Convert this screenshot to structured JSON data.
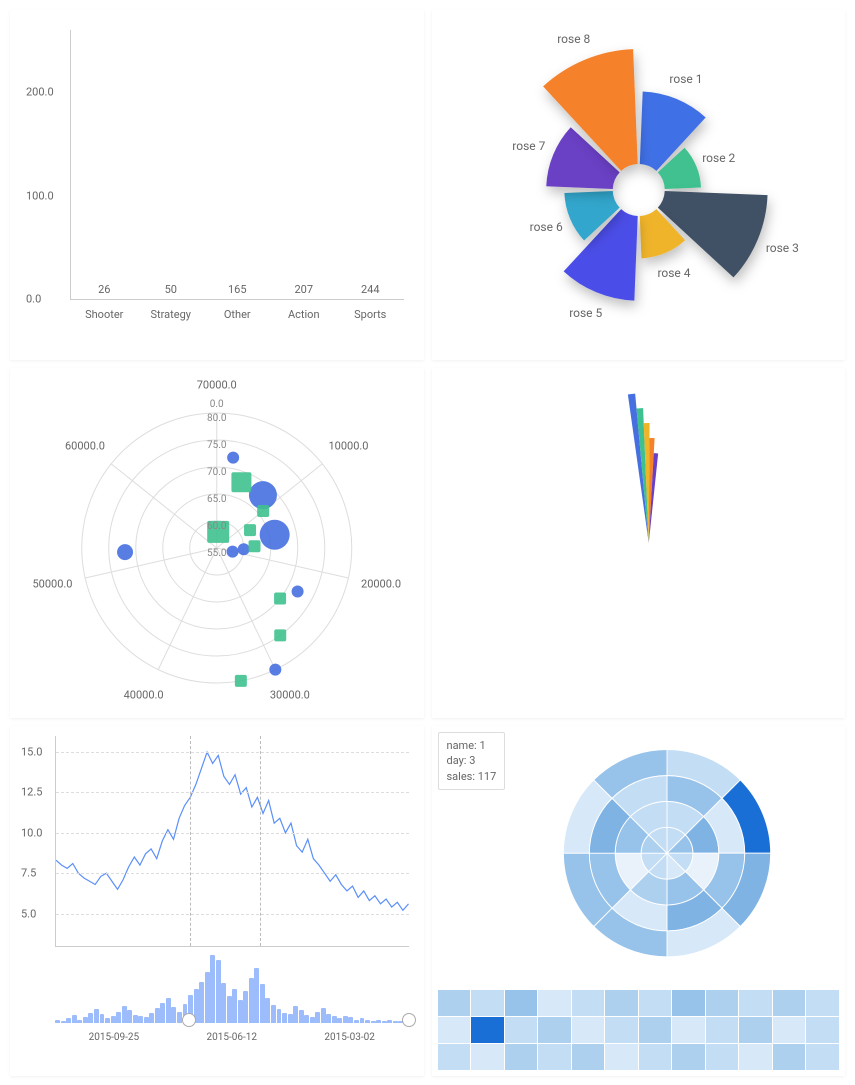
{
  "chart_data": [
    {
      "id": "bar",
      "type": "bar",
      "categories": [
        "Shooter",
        "Strategy",
        "Other",
        "Action",
        "Sports"
      ],
      "values": [
        26,
        50,
        165,
        207,
        244
      ],
      "ylim": [
        0,
        260
      ],
      "yticks": [
        0.0,
        100.0,
        200.0
      ],
      "bar_color": "#1890ff"
    },
    {
      "id": "rose",
      "type": "pie",
      "subtype": "nightingale-rose",
      "series": [
        {
          "name": "rose 1",
          "value": 60,
          "color": "#3f6fe6"
        },
        {
          "name": "rose 2",
          "value": 30,
          "color": "#3fc18f"
        },
        {
          "name": "rose 3",
          "value": 85,
          "color": "#415165"
        },
        {
          "name": "rose 4",
          "value": 35,
          "color": "#f0b429"
        },
        {
          "name": "rose 5",
          "value": 70,
          "color": "#4b4ee8"
        },
        {
          "name": "rose 6",
          "value": 40,
          "color": "#33a6cc"
        },
        {
          "name": "rose 7",
          "value": 55,
          "color": "#6a3fc4"
        },
        {
          "name": "rose 8",
          "value": 95,
          "color": "#f5822b"
        }
      ]
    },
    {
      "id": "polar_scatter",
      "type": "scatter",
      "coord": "polar",
      "radial_axis": {
        "label": "",
        "ticks": [
          55.0,
          60.0,
          65.0,
          70.0,
          75.0,
          80.0,
          0.0
        ]
      },
      "angle_axis": {
        "ticks": [
          10000.0,
          20000.0,
          30000.0,
          40000.0,
          50000.0,
          60000.0,
          70000.0
        ]
      },
      "series": [
        {
          "name": "blue",
          "marker": "circle",
          "color": "#4670e0",
          "points": [
            {
              "angle": 2000,
              "radius": 72,
              "size": 12
            },
            {
              "angle": 8000,
              "radius": 68,
              "size": 28
            },
            {
              "angle": 15000,
              "radius": 66,
              "size": 30
            },
            {
              "angle": 18000,
              "radius": 60,
              "size": 12
            },
            {
              "angle": 20000,
              "radius": 58,
              "size": 12
            },
            {
              "angle": 23000,
              "radius": 72,
              "size": 12
            },
            {
              "angle": 30000,
              "radius": 80,
              "size": 12
            },
            {
              "angle": 52000,
              "radius": 72,
              "size": 16
            }
          ]
        },
        {
          "name": "green",
          "marker": "square",
          "color": "#3fc18f",
          "points": [
            {
              "angle": 4000,
              "radius": 68,
              "size": 20
            },
            {
              "angle": 1000,
              "radius": 58,
              "size": 22
            },
            {
              "angle": 10000,
              "radius": 66,
              "size": 12
            },
            {
              "angle": 12000,
              "radius": 62,
              "size": 12
            },
            {
              "angle": 17000,
              "radius": 62,
              "size": 12
            },
            {
              "angle": 25000,
              "radius": 70,
              "size": 12
            },
            {
              "angle": 28000,
              "radius": 75,
              "size": 12
            },
            {
              "angle": 33000,
              "radius": 80,
              "size": 12
            }
          ]
        }
      ]
    },
    {
      "id": "building_rose",
      "type": "pie",
      "subtype": "narrow-fan",
      "series": [
        {
          "color": "#4670e0",
          "value": 100
        },
        {
          "color": "#3fc18f",
          "value": 90
        },
        {
          "color": "#f0b429",
          "value": 80
        },
        {
          "color": "#f5822b",
          "value": 70
        },
        {
          "color": "#6a3fc4",
          "value": 60
        }
      ],
      "start_angle": -8,
      "end_angle": 6
    },
    {
      "id": "timeseries",
      "type": "line",
      "xlabel": "",
      "ylabel": "",
      "xticks": [
        "2015-09-25",
        "2015-06-12",
        "2015-03-02"
      ],
      "yticks": [
        5.0,
        7.5,
        10.0,
        12.5,
        15.0
      ],
      "ylim": [
        3,
        16
      ],
      "cursor_positions": [
        0.38,
        0.58
      ],
      "brush_handles": [
        0.38,
        1.0
      ],
      "color": "#5b8ff9",
      "points": [
        8.3,
        8.0,
        7.8,
        8.1,
        7.5,
        7.2,
        7.0,
        6.8,
        7.3,
        7.5,
        7.0,
        6.5,
        7.1,
        7.9,
        8.5,
        8.0,
        8.7,
        9.0,
        8.4,
        9.5,
        10.2,
        9.6,
        10.9,
        11.7,
        12.2,
        13.0,
        14.0,
        15.0,
        14.3,
        14.8,
        13.5,
        13.0,
        13.6,
        12.4,
        12.8,
        11.6,
        12.2,
        11.2,
        12.0,
        10.6,
        10.9,
        10.0,
        10.6,
        9.2,
        8.8,
        9.6,
        8.4,
        8.0,
        7.5,
        7.0,
        7.4,
        6.8,
        6.4,
        6.7,
        6.0,
        6.4,
        5.8,
        6.1,
        5.6,
        5.9,
        5.4,
        5.7,
        5.2,
        5.6
      ],
      "brush_heights": [
        3,
        2,
        4,
        7,
        3,
        5,
        9,
        12,
        8,
        4,
        6,
        10,
        15,
        11,
        7,
        6,
        5,
        9,
        13,
        18,
        22,
        14,
        10,
        17,
        25,
        30,
        36,
        45,
        60,
        55,
        35,
        24,
        30,
        20,
        28,
        40,
        48,
        34,
        22,
        16,
        12,
        9,
        8,
        15,
        11,
        7,
        5,
        10,
        13,
        8,
        6,
        4,
        6,
        5,
        3,
        4,
        3,
        2,
        3,
        2,
        3,
        2,
        2,
        1
      ]
    },
    {
      "id": "polar_heatmap",
      "type": "heatmap",
      "coord": "polar",
      "tooltip": {
        "name": "1",
        "day": "3",
        "sales": "117"
      },
      "tooltip_labels": {
        "name": "name:",
        "day": "day:",
        "sales": "sales:"
      },
      "highlight": {
        "ring": 3,
        "sector": 1,
        "color": "#1a6fd6"
      },
      "palette": [
        "#e9f2fb",
        "#d7e8f8",
        "#c3ddf4",
        "#aed0ef",
        "#97c2ea",
        "#7fb3e3",
        "#5e9fd9",
        "#1a6fd6"
      ],
      "rings": 4,
      "sectors": 8
    },
    {
      "id": "grid_heatmap",
      "type": "heatmap",
      "rows": 3,
      "cols": 12,
      "highlight_cell": {
        "row": 1,
        "col": 1
      },
      "palette": [
        "#e9f2fb",
        "#d7e8f8",
        "#c3ddf4",
        "#aed0ef",
        "#97c2ea",
        "#7fb3e3",
        "#5e9fd9",
        "#1a6fd6"
      ],
      "cells": [
        3,
        2,
        4,
        1,
        2,
        3,
        2,
        4,
        3,
        2,
        3,
        2,
        1,
        7,
        2,
        3,
        1,
        2,
        3,
        1,
        2,
        3,
        1,
        2,
        2,
        1,
        3,
        2,
        3,
        1,
        2,
        3,
        2,
        1,
        3,
        2
      ]
    }
  ]
}
